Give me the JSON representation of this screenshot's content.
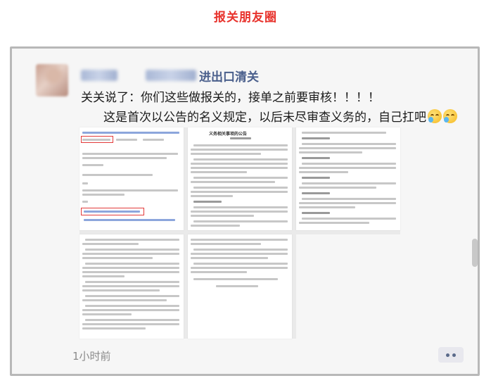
{
  "page": {
    "title": "报关朋友圈"
  },
  "post": {
    "author_suffix": "进出口清关",
    "line1": "关关说了：你们这些做报关的，接单之前要审核！！！！",
    "line2": "这是首次以公告的名义规定，以后未尽审查义务的，自己扛吧",
    "emojis": [
      "crying-laughing-icon",
      "crying-laughing-icon"
    ],
    "doc_heading": "义务相关事项的公告",
    "time": "1小时前"
  },
  "colors": {
    "title_red": "#e8322c",
    "author_blue": "#4a5f8c",
    "highlight_red": "#e23a3a"
  }
}
